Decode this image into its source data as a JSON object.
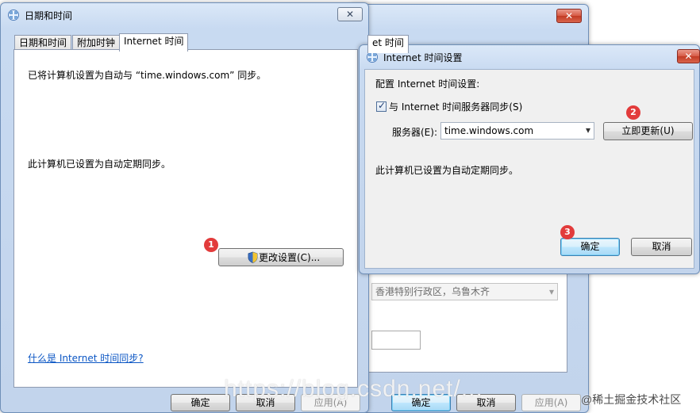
{
  "background_window": {
    "tab_partial": "et 时间",
    "timezone_value": "香港特别行政区，乌鲁木齐",
    "ok_label": "确定",
    "cancel_label": "取消",
    "apply_label": "应用(A)"
  },
  "datetime_window": {
    "title": "日期和时间",
    "tabs": [
      {
        "label": "日期和时间"
      },
      {
        "label": "附加时钟"
      },
      {
        "label": "Internet 时间"
      }
    ],
    "sync_text": "已将计算机设置为自动与 “time.windows.com” 同步。",
    "scheduled_text": "此计算机已设置为自动定期同步。",
    "change_settings_label": "更改设置(C)...",
    "help_link": "什么是 Internet 时间同步?",
    "ok_label": "确定",
    "cancel_label": "取消",
    "apply_label": "应用(A)",
    "close_label": "✕"
  },
  "internet_time_dialog": {
    "title": "Internet 时间设置",
    "heading": "配置 Internet 时间设置:",
    "sync_checkbox_label": "与 Internet 时间服务器同步(S)",
    "sync_checked": true,
    "server_label": "服务器(E):",
    "server_value": "time.windows.com",
    "update_now_label": "立即更新(U)",
    "status_text": "此计算机已设置为自动定期同步。",
    "ok_label": "确定",
    "cancel_label": "取消",
    "close_label": "✕"
  },
  "step_markers": [
    "1",
    "2",
    "3"
  ],
  "watermarks": {
    "url": "https://blog.csdn.net/...",
    "site": "@稀土掘金技术社区"
  },
  "colors": {
    "marker_red": "#e23b3b",
    "close_red": "#c23b24",
    "link_blue": "#0b56c4"
  }
}
